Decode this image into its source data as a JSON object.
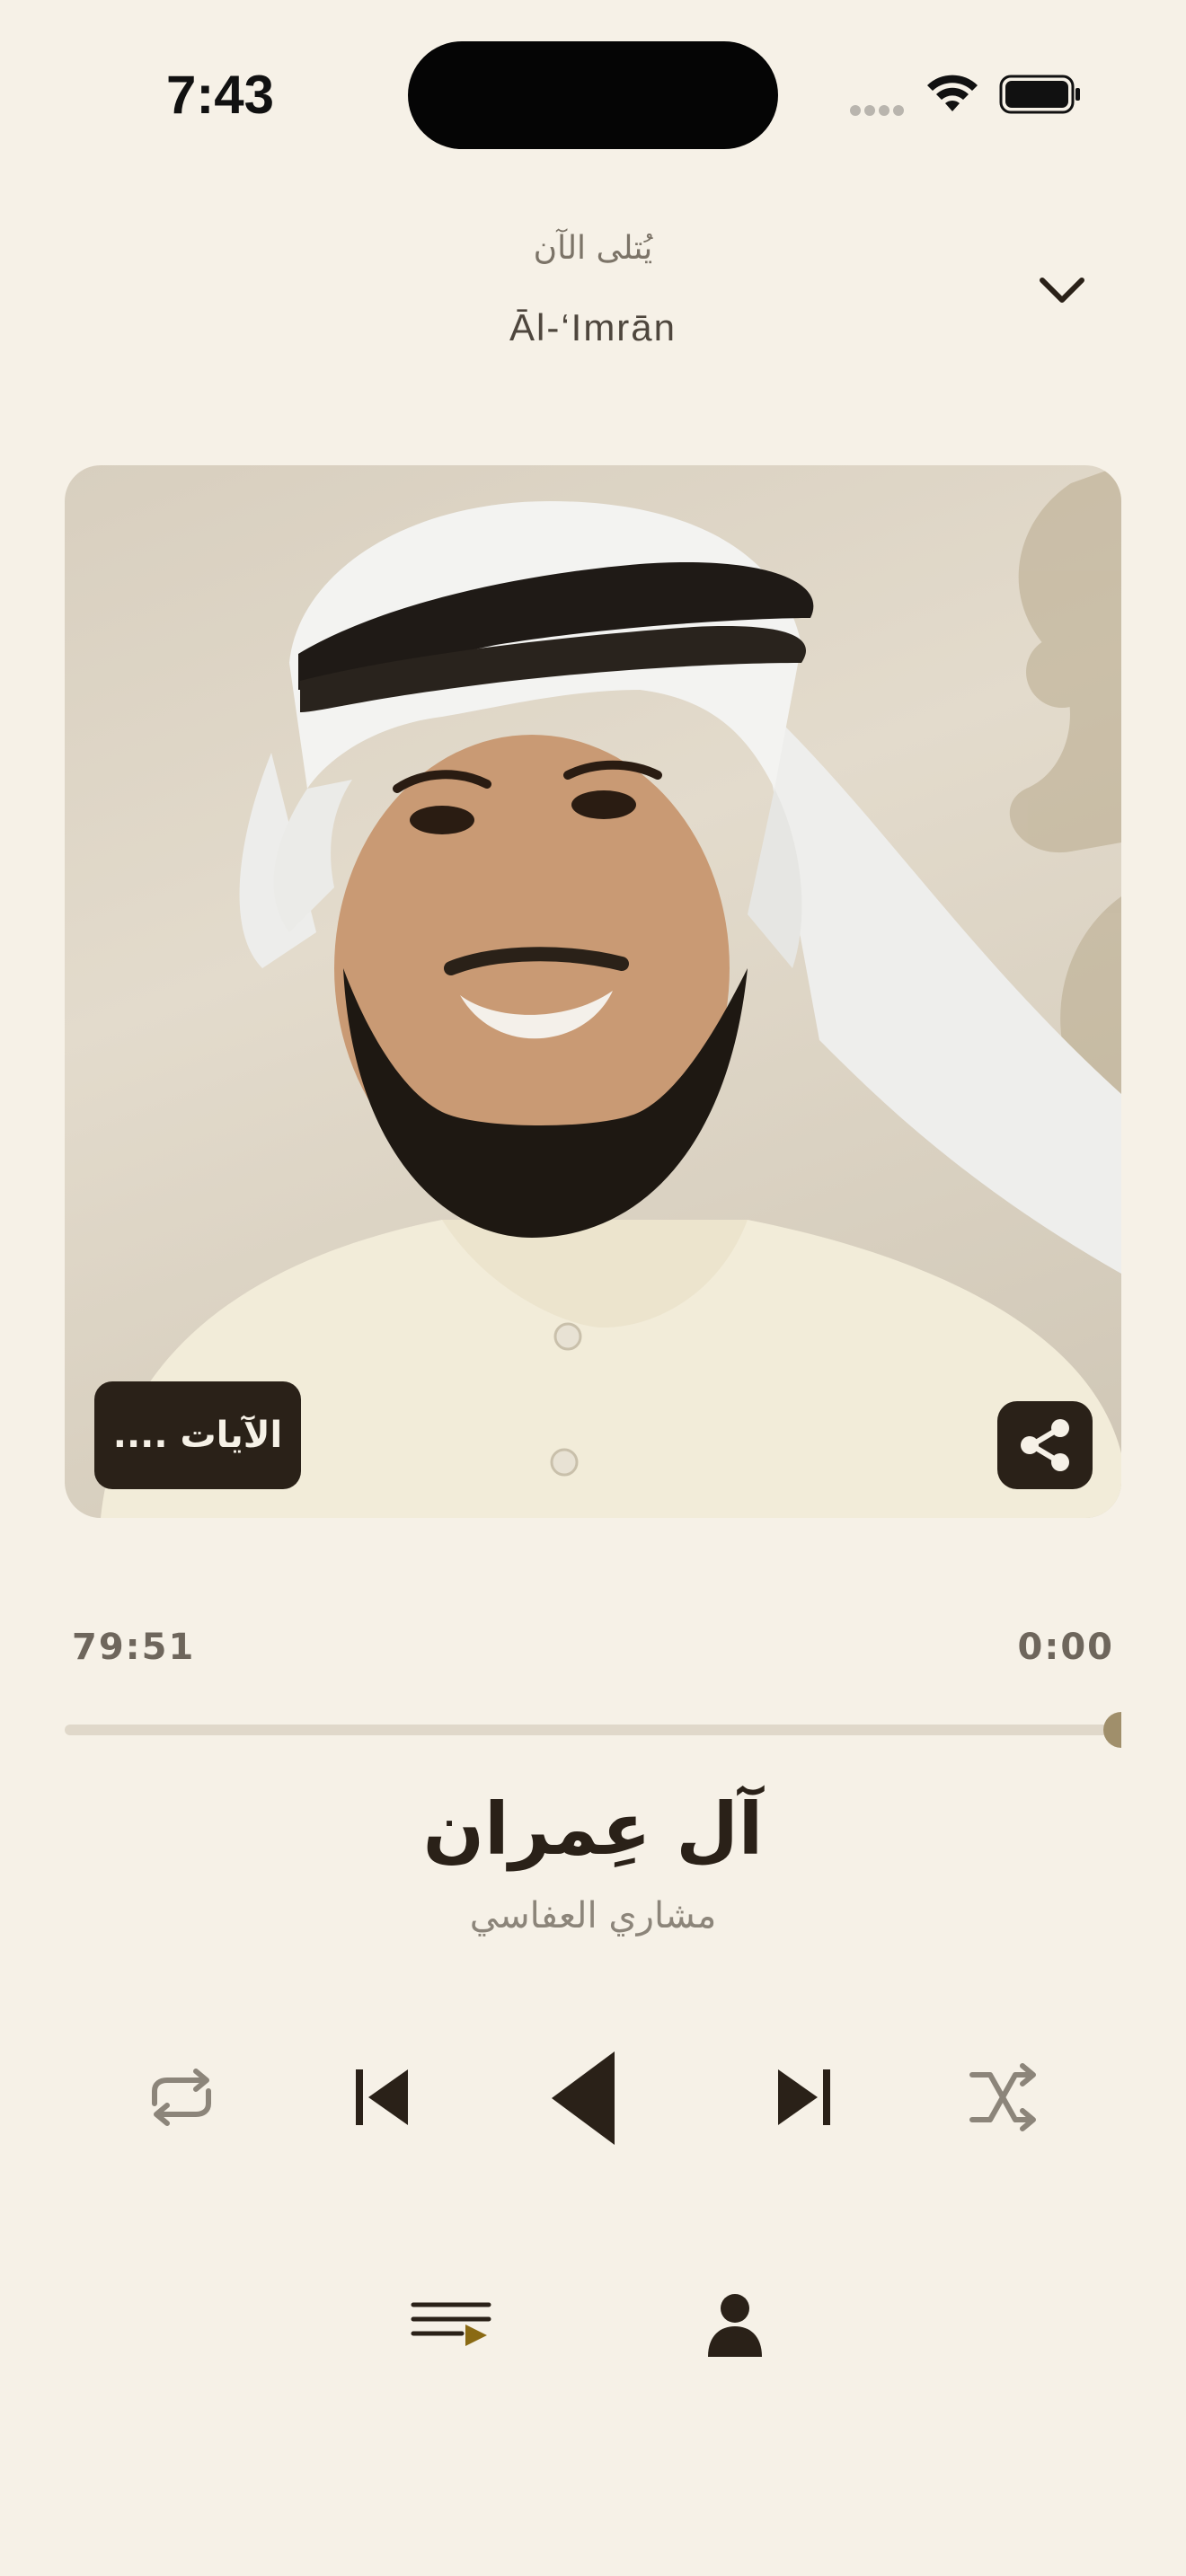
{
  "status_bar": {
    "time": "7:43"
  },
  "header": {
    "now_playing_label": "يُتلى الآن",
    "surah_transliteration": "Āl-‘Imrān"
  },
  "artwork": {
    "verses_button_label": "الآيات ....",
    "share_icon": "share-icon"
  },
  "playback": {
    "total_time": "79:51",
    "elapsed_time": "0:00",
    "progress": 0
  },
  "track": {
    "title": "آل عِمران",
    "reciter": "مشاري العفاسي"
  },
  "controls": {
    "repeat_icon": "repeat-icon",
    "previous_icon": "skip-previous-icon",
    "play_icon": "play-icon",
    "next_icon": "skip-next-icon",
    "shuffle_icon": "shuffle-icon"
  },
  "bottom_bar": {
    "queue_icon": "queue-icon",
    "reciter_icon": "person-icon"
  },
  "colors": {
    "background": "#f6f1e7",
    "dark": "#2a2118",
    "accent": "#a08f6b"
  }
}
